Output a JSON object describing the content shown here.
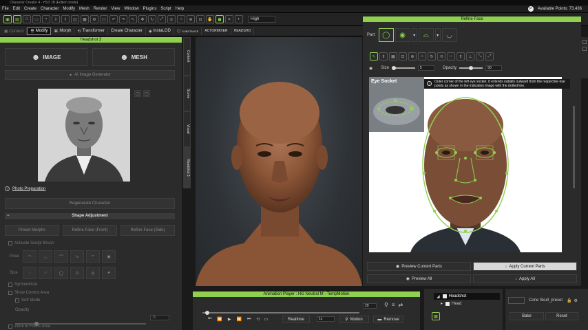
{
  "window": {
    "title": "Character Creator 4 - HS3 1B [Edition mode]"
  },
  "menu": [
    "File",
    "Edit",
    "Create",
    "Character",
    "Modify",
    "Mesh",
    "Render",
    "View",
    "Window",
    "Plugins",
    "Script",
    "Help"
  ],
  "points_label": "Available Points: 73,436",
  "toolbar": {
    "quality": "High"
  },
  "toolbar2": {
    "modify": "Modify",
    "morph": "Morph",
    "transformer": "Transformer",
    "create_character": "Create Character",
    "instalod": "InstaLOD",
    "substance": "SUBSTANCE",
    "actormixer": "ACTORMIXER",
    "headshot": "HEADSHO"
  },
  "headshot_panel": {
    "title": "Headshot 3",
    "image": "IMAGE",
    "mesh": "MESH",
    "ai_gen": "AI Image Generator",
    "photo_prep": "Photo Preparation",
    "regenerate": "Regenerate Character",
    "shape_adj": "Shape Adjustment",
    "preset_morphs": "Preset Morphs",
    "refine_face_front": "Refine Face (Front)",
    "refine_face_side": "Refine Face (Side)",
    "activate_sculpt": "Activate Sculpt Brush",
    "pose_label": "Pose",
    "size_label": "Size",
    "symmetrical": "Symmetrical",
    "show_control": "Show Control Area",
    "soft_mode": "Soft Mode",
    "opacity": "Opacity",
    "opacity_val": "15",
    "zone": "Zone in Focus Area"
  },
  "side_tabs": [
    "Content",
    "Scene",
    "Visual",
    "Headshot 3"
  ],
  "refine_face": {
    "title": "Refine Face",
    "part_label": "Part:",
    "size_label": "Size",
    "size_val": "5",
    "opacity_label": "Opacity",
    "opacity_val": "50",
    "eye_socket": "Eye Socket",
    "tooltip": "Outer corner of the left eye socket. It extends radially outward from the respective eye points as shown in the indication image with the dotted line.",
    "preview_current": "Preview Current Parts",
    "apply_current": "Apply Current Parts",
    "preview_all": "Preview All",
    "apply_all": "Apply All"
  },
  "anim_player": {
    "title": "Animation Player : HG Neutral M - TempMotion",
    "frame": "29",
    "realtime": "Realtime",
    "speed": "1x",
    "motion": "Motion",
    "remove": "Remove"
  },
  "tree": {
    "headshot": "Headshot",
    "head": "Head"
  },
  "bottom_right": {
    "preset": "Cone Skull_preset",
    "bake": "Bake",
    "reset": "Reset"
  }
}
